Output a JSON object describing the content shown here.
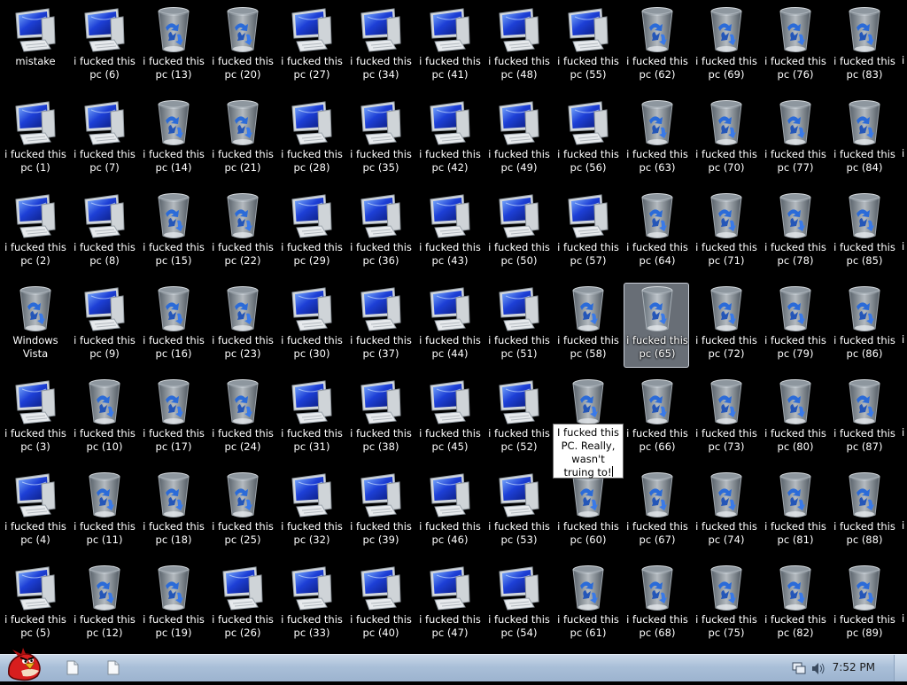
{
  "desktop": {
    "icons": [
      {
        "label": "mistake",
        "type": "computer"
      },
      {
        "label": "i fucked this pc (1)",
        "type": "computer"
      },
      {
        "label": "i fucked this pc (2)",
        "type": "computer"
      },
      {
        "label": "Windows Vista",
        "type": "recycle"
      },
      {
        "label": "i fucked this pc (3)",
        "type": "computer"
      },
      {
        "label": "i fucked this pc (4)",
        "type": "computer"
      },
      {
        "label": "i fucked this pc (5)",
        "type": "computer"
      },
      {
        "label": "i fucked this pc (6)",
        "type": "computer"
      },
      {
        "label": "i fucked this pc (7)",
        "type": "computer"
      },
      {
        "label": "i fucked this pc (8)",
        "type": "computer"
      },
      {
        "label": "i fucked this pc (9)",
        "type": "computer"
      },
      {
        "label": "i fucked this pc (10)",
        "type": "recycle"
      },
      {
        "label": "i fucked this pc (11)",
        "type": "recycle"
      },
      {
        "label": "i fucked this pc (12)",
        "type": "recycle"
      },
      {
        "label": "i fucked this pc (13)",
        "type": "recycle"
      },
      {
        "label": "i fucked this pc (14)",
        "type": "recycle"
      },
      {
        "label": "i fucked this pc (15)",
        "type": "recycle"
      },
      {
        "label": "i fucked this pc (16)",
        "type": "recycle"
      },
      {
        "label": "i fucked this pc (17)",
        "type": "recycle"
      },
      {
        "label": "i fucked this pc (18)",
        "type": "recycle"
      },
      {
        "label": "i fucked this pc (19)",
        "type": "recycle"
      },
      {
        "label": "i fucked this pc (20)",
        "type": "recycle"
      },
      {
        "label": "i fucked this pc (21)",
        "type": "recycle"
      },
      {
        "label": "i fucked this pc (22)",
        "type": "recycle"
      },
      {
        "label": "i fucked this pc (23)",
        "type": "recycle"
      },
      {
        "label": "i fucked this pc (24)",
        "type": "recycle"
      },
      {
        "label": "i fucked this pc (25)",
        "type": "recycle"
      },
      {
        "label": "i fucked this pc (26)",
        "type": "computer"
      },
      {
        "label": "i fucked this pc (27)",
        "type": "computer"
      },
      {
        "label": "i fucked this pc (28)",
        "type": "computer"
      },
      {
        "label": "i fucked this pc (29)",
        "type": "computer"
      },
      {
        "label": "i fucked this pc (30)",
        "type": "computer"
      },
      {
        "label": "i fucked this pc (31)",
        "type": "computer"
      },
      {
        "label": "i fucked this pc (32)",
        "type": "computer"
      },
      {
        "label": "i fucked this pc (33)",
        "type": "computer"
      },
      {
        "label": "i fucked this pc (34)",
        "type": "computer"
      },
      {
        "label": "i fucked this pc (35)",
        "type": "computer"
      },
      {
        "label": "i fucked this pc (36)",
        "type": "computer"
      },
      {
        "label": "i fucked this pc (37)",
        "type": "computer"
      },
      {
        "label": "i fucked this pc (38)",
        "type": "computer"
      },
      {
        "label": "i fucked this pc (39)",
        "type": "computer"
      },
      {
        "label": "i fucked this pc (40)",
        "type": "computer"
      },
      {
        "label": "i fucked this pc (41)",
        "type": "computer"
      },
      {
        "label": "i fucked this pc (42)",
        "type": "computer"
      },
      {
        "label": "i fucked this pc (43)",
        "type": "computer"
      },
      {
        "label": "i fucked this pc (44)",
        "type": "computer"
      },
      {
        "label": "i fucked this pc (45)",
        "type": "computer"
      },
      {
        "label": "i fucked this pc (46)",
        "type": "computer"
      },
      {
        "label": "i fucked this pc (47)",
        "type": "computer"
      },
      {
        "label": "i fucked this pc (48)",
        "type": "computer"
      },
      {
        "label": "i fucked this pc (49)",
        "type": "computer"
      },
      {
        "label": "i fucked this pc (50)",
        "type": "computer"
      },
      {
        "label": "i fucked this pc (51)",
        "type": "computer"
      },
      {
        "label": "i fucked this pc (52)",
        "type": "computer"
      },
      {
        "label": "i fucked this pc (53)",
        "type": "computer"
      },
      {
        "label": "i fucked this pc (54)",
        "type": "computer"
      },
      {
        "label": "i fucked this pc (55)",
        "type": "computer"
      },
      {
        "label": "i fucked this pc (56)",
        "type": "computer"
      },
      {
        "label": "i fucked this pc (57)",
        "type": "computer"
      },
      {
        "label": "i fucked this pc (58)",
        "type": "recycle"
      },
      {
        "label": "",
        "type": "recycle",
        "renaming": true
      },
      {
        "label": "i fucked this pc (60)",
        "type": "recycle"
      },
      {
        "label": "i fucked this pc (61)",
        "type": "recycle"
      },
      {
        "label": "i fucked this pc (62)",
        "type": "recycle"
      },
      {
        "label": "i fucked this pc (63)",
        "type": "recycle"
      },
      {
        "label": "i fucked this pc (64)",
        "type": "recycle"
      },
      {
        "label": "i fucked this pc (65)",
        "type": "recycle",
        "selected": true
      },
      {
        "label": "i fucked this pc (66)",
        "type": "recycle"
      },
      {
        "label": "i fucked this pc (67)",
        "type": "recycle"
      },
      {
        "label": "i fucked this pc (68)",
        "type": "recycle"
      },
      {
        "label": "i fucked this pc (69)",
        "type": "recycle"
      },
      {
        "label": "i fucked this pc (70)",
        "type": "recycle"
      },
      {
        "label": "i fucked this pc (71)",
        "type": "recycle"
      },
      {
        "label": "i fucked this pc (72)",
        "type": "recycle"
      },
      {
        "label": "i fucked this pc (73)",
        "type": "recycle"
      },
      {
        "label": "i fucked this pc (74)",
        "type": "recycle"
      },
      {
        "label": "i fucked this pc (75)",
        "type": "recycle"
      },
      {
        "label": "i fucked this pc (76)",
        "type": "recycle"
      },
      {
        "label": "i fucked this pc (77)",
        "type": "recycle"
      },
      {
        "label": "i fucked this pc (78)",
        "type": "recycle"
      },
      {
        "label": "i fucked this pc (79)",
        "type": "recycle"
      },
      {
        "label": "i fucked this pc (80)",
        "type": "recycle"
      },
      {
        "label": "i fucked this pc (81)",
        "type": "recycle"
      },
      {
        "label": "i fucked this pc (82)",
        "type": "recycle"
      },
      {
        "label": "i fucked this pc (83)",
        "type": "recycle"
      },
      {
        "label": "i fucked this pc (84)",
        "type": "recycle"
      },
      {
        "label": "i fucked this pc (85)",
        "type": "recycle"
      },
      {
        "label": "i fucked this pc (86)",
        "type": "recycle"
      },
      {
        "label": "i fucked this pc (87)",
        "type": "recycle"
      },
      {
        "label": "i fucked this pc (88)",
        "type": "recycle"
      },
      {
        "label": "i fucked this pc (89)",
        "type": "recycle"
      }
    ],
    "edge_stub_text": "i",
    "rename_box_text": "I fucked this PC. Really, wasn't truing to!"
  },
  "taskbar": {
    "start_icon": "angry-bird-start-orb",
    "pinned": [
      {
        "icon": "document-icon"
      },
      {
        "icon": "document-icon"
      }
    ],
    "tray_icons": [
      "network-icon",
      "volume-icon"
    ],
    "clock": "7:52 PM"
  },
  "colors": {
    "desktop_bg": "#000000",
    "taskbar": "#a9bfd8",
    "selection": "#bec8d7"
  }
}
